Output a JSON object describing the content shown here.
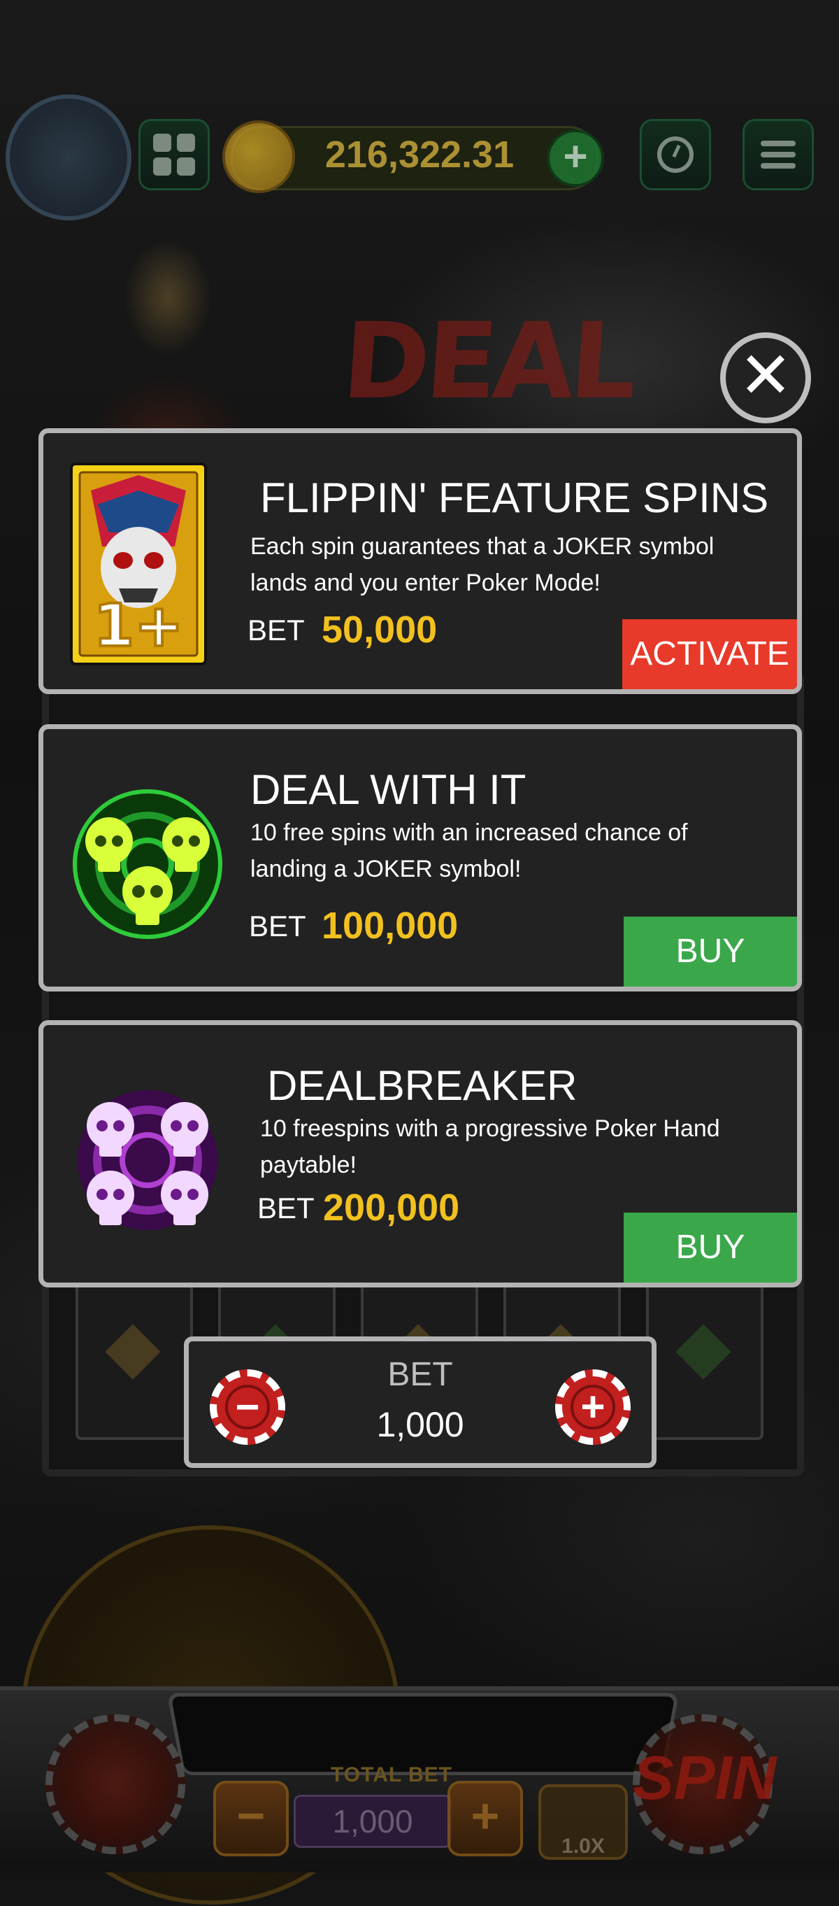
{
  "header": {
    "balance": "216,322.31"
  },
  "background": {
    "logo_text": "DEAL WITH IT",
    "total_bet_label": "TOTAL BET",
    "total_bet_value": "1,000",
    "speed_label": "1.0X",
    "spin_label": "SPIN"
  },
  "modal": {
    "close_icon": "close-icon",
    "cards": [
      {
        "title": "FLIPPIN' FEATURE SPINS",
        "description": "Each spin guarantees that a JOKER symbol lands and you enter Poker Mode!",
        "bet_label": "BET",
        "bet_value": "50,000",
        "action_label": "ACTIVATE",
        "icon": "joker-card-icon",
        "action_color": "#e73a2a"
      },
      {
        "title": "DEAL WITH IT",
        "description": "10 free spins with an increased chance of landing a JOKER symbol!",
        "bet_label": "BET",
        "bet_value": "100,000",
        "action_label": "BUY",
        "icon": "green-skulls-icon",
        "action_color": "#3aa84a"
      },
      {
        "title": "DEALBREAKER",
        "description": "10 freespins with a progressive Poker Hand paytable!",
        "bet_label": "BET",
        "bet_value": "200,000",
        "action_label": "BUY",
        "icon": "purple-skulls-icon",
        "action_color": "#3aa84a"
      }
    ],
    "bet_selector": {
      "label": "BET",
      "value": "1,000"
    }
  },
  "colors": {
    "bet_value": "#f2c11f",
    "card_border": "#b3b3b3",
    "card_bg": "#222222"
  }
}
